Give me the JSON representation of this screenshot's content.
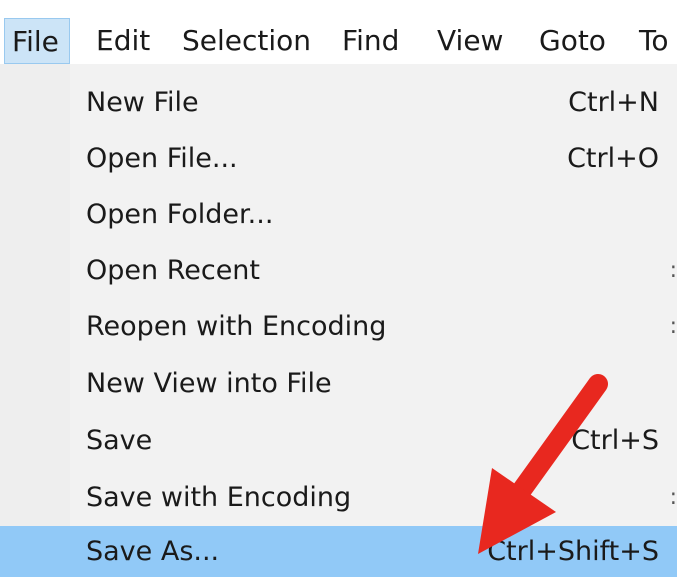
{
  "menubar": {
    "items": [
      {
        "label": "File",
        "active": true
      },
      {
        "label": "Edit"
      },
      {
        "label": "Selection"
      },
      {
        "label": "Find"
      },
      {
        "label": "View"
      },
      {
        "label": "Goto"
      },
      {
        "label": "To"
      }
    ]
  },
  "file_menu": {
    "items": [
      {
        "label": "New File",
        "shortcut": "Ctrl+N"
      },
      {
        "label": "Open File...",
        "shortcut": "Ctrl+O"
      },
      {
        "label": "Open Folder...",
        "shortcut": ""
      },
      {
        "label": "Open Recent",
        "has_submenu": true
      },
      {
        "label": "Reopen with Encoding",
        "has_submenu": true
      },
      {
        "label": "New View into File",
        "shortcut": ""
      },
      {
        "label": "Save",
        "shortcut": "Ctrl+S"
      },
      {
        "label": "Save with Encoding",
        "has_submenu": true
      },
      {
        "label": "Save As...",
        "shortcut": "Ctrl+Shift+S",
        "highlighted": true
      }
    ],
    "submenu_glyph": ":"
  },
  "colors": {
    "active_menubar_bg": "#cce4f7",
    "highlight_bg": "#91c9f7",
    "menu_bg": "#f2f2f2",
    "annotation_arrow": "#e8281f"
  }
}
